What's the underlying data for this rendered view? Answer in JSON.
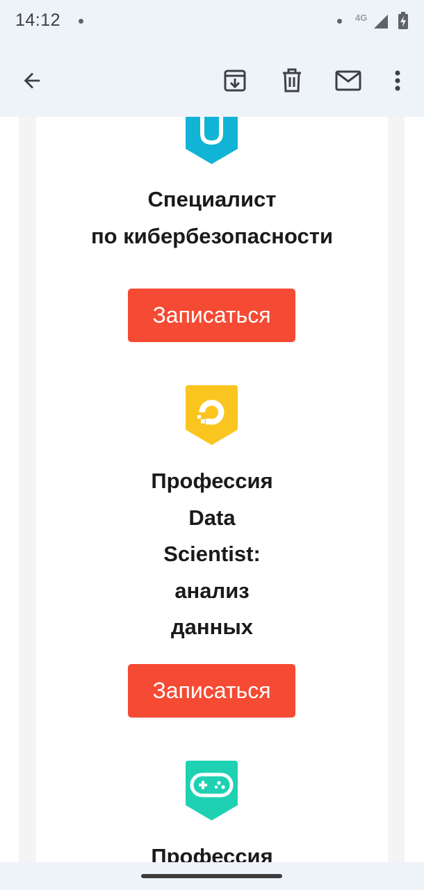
{
  "status_bar": {
    "time": "14:12",
    "network": "4G",
    "icons": [
      "notification-dot",
      "notification-dot",
      "signal-icon",
      "battery-icon"
    ]
  },
  "toolbar": {
    "icons": [
      "back-arrow-icon",
      "archive-icon",
      "delete-icon",
      "mail-icon",
      "more-vert-icon"
    ]
  },
  "colors": {
    "accent_button": "#f54a33",
    "badge_cyber": "#12b4d6",
    "badge_data": "#fbc51f",
    "badge_game": "#1fd1b3",
    "title_text": "#1a1a1a"
  },
  "courses": [
    {
      "title_lines": [
        "Специалист",
        "по кибербезопасности"
      ],
      "button_label": "Записаться",
      "icon": "shield-keyhole-icon"
    },
    {
      "title_lines": [
        "Профессия",
        "Data",
        "Scientist:",
        "анализ",
        "данных"
      ],
      "button_label": "Записаться",
      "icon": "data-science-logo-icon"
    },
    {
      "title_lines": [
        "Профессия"
      ],
      "icon": "gamepad-icon"
    }
  ]
}
